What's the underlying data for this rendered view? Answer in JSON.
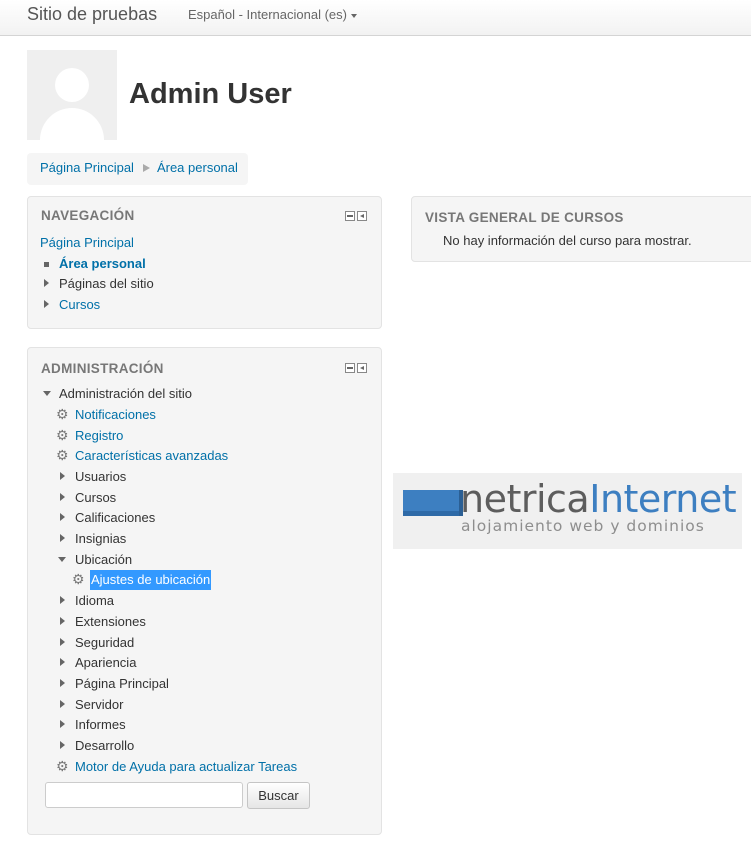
{
  "header": {
    "site_name": "Sitio de pruebas",
    "language": "Español - Internacional (es)"
  },
  "profile": {
    "name": "Admin User"
  },
  "breadcrumb": [
    "Página Principal",
    "Área personal"
  ],
  "navigation": {
    "title": "NAVEGACIÓN",
    "home": "Página Principal",
    "items": [
      {
        "label": "Área personal",
        "current": true
      },
      {
        "label": "Páginas del sitio"
      },
      {
        "label": "Cursos"
      }
    ]
  },
  "administration": {
    "title": "ADMINISTRACIÓN",
    "root": "Administración del sitio",
    "items": [
      "Notificaciones",
      "Registro",
      "Características avanzadas",
      "Usuarios",
      "Cursos",
      "Calificaciones",
      "Insignias",
      "Ubicación",
      "Ajustes de ubicación",
      "Idioma",
      "Extensiones",
      "Seguridad",
      "Apariencia",
      "Página Principal",
      "Servidor",
      "Informes",
      "Desarrollo",
      "Motor de Ayuda para actualizar Tareas"
    ],
    "search_button": "Buscar",
    "search_value": ""
  },
  "course_overview": {
    "title": "VISTA GENERAL DE CURSOS",
    "empty_message": "No hay información del curso para mostrar."
  },
  "ad": {
    "name_part1": "netrica",
    "name_part2": "Internet",
    "tagline": "alojamiento web y dominios"
  },
  "colors": {
    "link": "#0070a8",
    "highlight": "#3399ff",
    "brand_blue": "#3d7fc1"
  }
}
